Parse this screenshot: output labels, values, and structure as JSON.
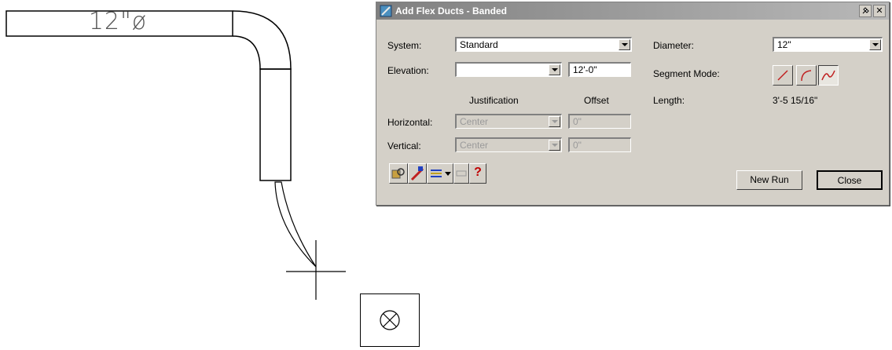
{
  "drawing": {
    "duct_label": "12\"ø"
  },
  "dialog": {
    "title": "Add Flex Ducts - Banded",
    "system": {
      "label": "System:",
      "value": "Standard"
    },
    "elevation": {
      "label": "Elevation:",
      "value": "",
      "offset_value": "12'-0\""
    },
    "diameter": {
      "label": "Diameter:",
      "value": "12\""
    },
    "segment_mode": {
      "label": "Segment Mode:"
    },
    "length": {
      "label": "Length:",
      "value": "3'-5 15/16\""
    },
    "justification_header": "Justification",
    "offset_header": "Offset",
    "horizontal": {
      "label": "Horizontal:",
      "value": "Center",
      "offset": "0\""
    },
    "vertical": {
      "label": "Vertical:",
      "value": "Center",
      "offset": "0\""
    },
    "help_label": "?",
    "new_run_label": "New Run",
    "close_label": "Close"
  }
}
